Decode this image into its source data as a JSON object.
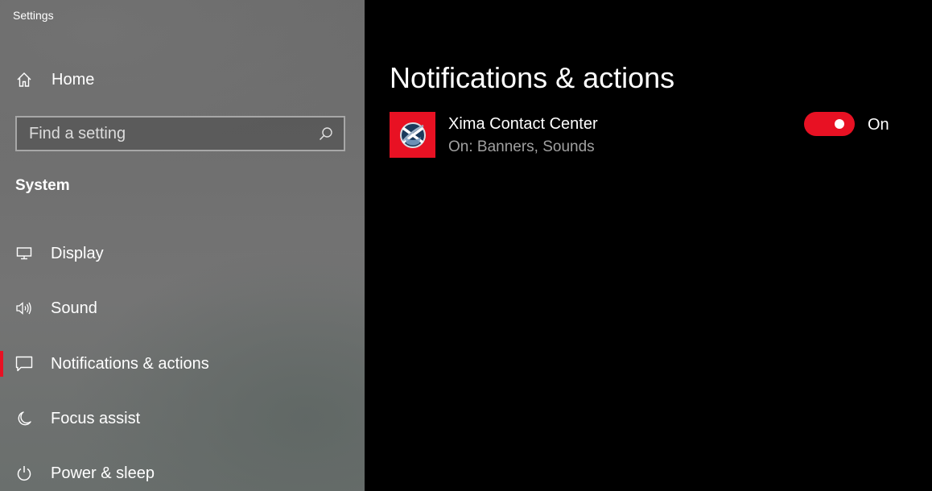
{
  "window": {
    "title": "Settings"
  },
  "sidebar": {
    "home_label": "Home",
    "search": {
      "placeholder": "Find a setting"
    },
    "section_title": "System",
    "items": [
      {
        "label": "Display",
        "icon": "display-icon"
      },
      {
        "label": "Sound",
        "icon": "speaker-icon"
      },
      {
        "label": "Notifications & actions",
        "icon": "notification-icon",
        "selected": true
      },
      {
        "label": "Focus assist",
        "icon": "moon-icon"
      },
      {
        "label": "Power & sleep",
        "icon": "power-icon"
      }
    ]
  },
  "main": {
    "title": "Notifications & actions",
    "app": {
      "name": "Xima Contact Center",
      "subtitle": "On: Banners, Sounds",
      "icon": "xima-logo-icon",
      "toggle_state": "On"
    }
  },
  "colors": {
    "accent": "#e81123",
    "secondary_text": "#a0a0a0"
  }
}
